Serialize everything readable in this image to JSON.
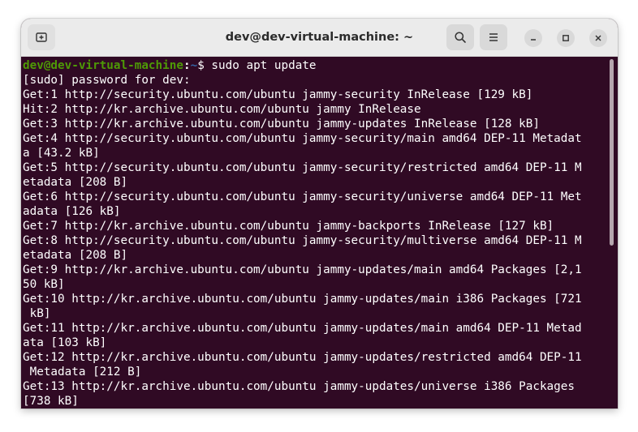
{
  "window": {
    "title": "dev@dev-virtual-machine: ~"
  },
  "icons": {
    "new_tab": "new-tab-icon",
    "search": "search-icon",
    "menu": "hamburger-menu-icon",
    "minimize": "minimize-icon",
    "maximize": "maximize-icon",
    "close": "close-icon"
  },
  "colors": {
    "terminal_bg": "#300a24",
    "prompt_user": "#4e9a06",
    "prompt_path": "#3465a4",
    "text": "#ffffff",
    "titlebar_bg": "#ebebeb"
  },
  "terminal": {
    "prompt": {
      "user_host": "dev@dev-virtual-machine",
      "colon": ":",
      "path": "~",
      "symbol": "$ ",
      "command": "sudo apt update"
    },
    "lines": [
      "[sudo] password for dev:",
      "Get:1 http://security.ubuntu.com/ubuntu jammy-security InRelease [129 kB]",
      "Hit:2 http://kr.archive.ubuntu.com/ubuntu jammy InRelease",
      "Get:3 http://kr.archive.ubuntu.com/ubuntu jammy-updates InRelease [128 kB]",
      "Get:4 http://security.ubuntu.com/ubuntu jammy-security/main amd64 DEP-11 Metadat",
      "a [43.2 kB]",
      "Get:5 http://security.ubuntu.com/ubuntu jammy-security/restricted amd64 DEP-11 M",
      "etadata [208 B]",
      "Get:6 http://security.ubuntu.com/ubuntu jammy-security/universe amd64 DEP-11 Met",
      "adata [126 kB]",
      "Get:7 http://kr.archive.ubuntu.com/ubuntu jammy-backports InRelease [127 kB]",
      "Get:8 http://security.ubuntu.com/ubuntu jammy-security/multiverse amd64 DEP-11 M",
      "etadata [208 B]",
      "Get:9 http://kr.archive.ubuntu.com/ubuntu jammy-updates/main amd64 Packages [2,1",
      "50 kB]",
      "Get:10 http://kr.archive.ubuntu.com/ubuntu jammy-updates/main i386 Packages [721",
      " kB]",
      "Get:11 http://kr.archive.ubuntu.com/ubuntu jammy-updates/main amd64 DEP-11 Metad",
      "ata [103 kB]",
      "Get:12 http://kr.archive.ubuntu.com/ubuntu jammy-updates/restricted amd64 DEP-11",
      " Metadata [212 B]",
      "Get:13 http://kr.archive.ubuntu.com/ubuntu jammy-updates/universe i386 Packages",
      "[738 kB]"
    ]
  }
}
